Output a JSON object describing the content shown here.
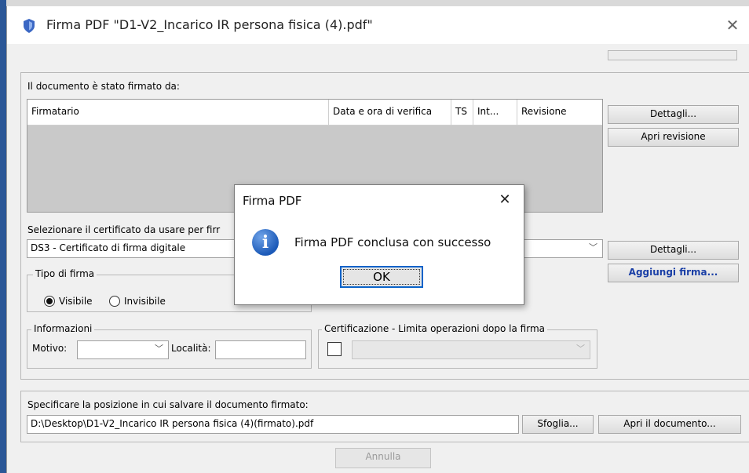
{
  "window": {
    "title": "Firma PDF \"D1-V2_Incarico IR persona fisica (4).pdf\"",
    "close_glyph": "✕"
  },
  "signers": {
    "label": "Il documento è stato firmato da:",
    "columns": [
      "Firmatario",
      "Data e ora di verifica",
      "TS",
      "Int...",
      "Revisione"
    ],
    "rows": [],
    "details_button": "Dettagli...",
    "open_revision_button": "Apri revisione"
  },
  "certificate": {
    "label": "Selezionare il certificato da usare per firr",
    "selected": "DS3 - Certificato di firma digitale",
    "details_button": "Dettagli...",
    "add_signature_button": "Aggiungi firma..."
  },
  "signature_type": {
    "legend": "Tipo di firma",
    "options": [
      {
        "label": "Visibile",
        "selected": true
      },
      {
        "label": "Invisibile",
        "selected": false
      }
    ]
  },
  "info": {
    "legend": "Informazioni",
    "motivo_label": "Motivo:",
    "motivo_value": "",
    "localita_label": "Località:",
    "localita_value": ""
  },
  "certification": {
    "legend": "Certificazione - Limita operazioni dopo la firma",
    "checked": false,
    "selected": ""
  },
  "output": {
    "label": "Specificare la posizione in cui salvare il documento firmato:",
    "path": "D:\\Desktop\\D1-V2_Incarico IR persona fisica (4)(firmato).pdf",
    "browse_button": "Sfoglia...",
    "open_document_button": "Apri il documento..."
  },
  "cancel_button": "Annulla",
  "dialog": {
    "title": "Firma PDF",
    "close_glyph": "✕",
    "message": "Firma PDF conclusa con successo",
    "ok_button": "OK",
    "icon": "info-icon"
  },
  "colors": {
    "accent_blue": "#1a3fa6",
    "focus_border": "#0a63c9"
  }
}
